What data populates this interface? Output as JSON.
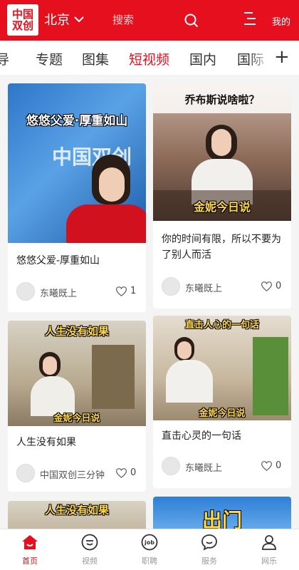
{
  "header": {
    "logo_line1": "中国",
    "logo_line2": "双创",
    "city": "北京",
    "search_label": "搜索",
    "mine_label": "我的"
  },
  "tabs": [
    {
      "label": "导"
    },
    {
      "label": "专题"
    },
    {
      "label": "图集"
    },
    {
      "label": "短视频",
      "active": true
    },
    {
      "label": "国内"
    },
    {
      "label": "国际"
    }
  ],
  "tabs_add": "+",
  "cards": [
    {
      "thumb_caption": "悠悠父爱·厚重如山",
      "title": "悠悠父爱-厚重如山",
      "author": "东曦既上",
      "likes": "1"
    },
    {
      "thumb_caption": "乔布斯说啥啦？",
      "thumb_badge": "金妮今日说",
      "title": "你的时间有限，所以不要为了别人而活",
      "author": "东曦既上",
      "likes": "0"
    },
    {
      "thumb_caption": "人生没有如果",
      "thumb_badge": "金妮今日说",
      "title": "人生没有如果",
      "author": "中国双创三分钟",
      "likes": "0"
    },
    {
      "thumb_caption": "直击人心的一句话",
      "thumb_badge": "金妮今日说",
      "title": "直击心灵的一句话",
      "author": "东曦既上",
      "likes": "0"
    },
    {
      "thumb_caption": "人生没有如果"
    },
    {
      "thumb_caption": "出门"
    }
  ],
  "thumb1_bg_text": "中国双创",
  "bottom_nav": [
    {
      "label": "首页",
      "active": true
    },
    {
      "label": "视频"
    },
    {
      "label": "职聘"
    },
    {
      "label": "服务"
    },
    {
      "label": "网乐"
    }
  ],
  "colors": {
    "brand_red": "#e60f1e",
    "caption_yellow": "#ffd84a"
  }
}
